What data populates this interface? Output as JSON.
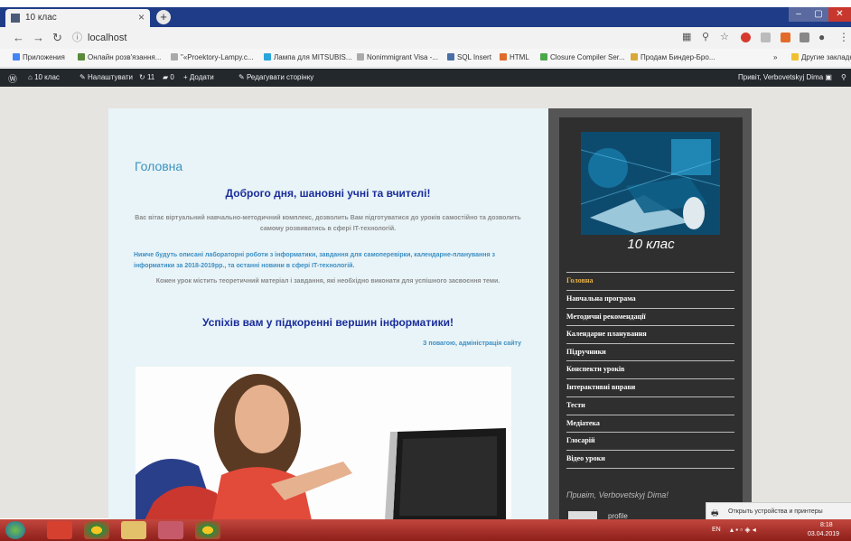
{
  "browser": {
    "tab_title": "10 клас",
    "url": "localhost",
    "bookmarks": [
      "Приложения",
      "Онлайн розв'язання...",
      "\"«Proektory-Lampy.c...",
      "Лампа для MITSUBIS...",
      "Nonimmigrant Visa -...",
      "SQL Insert",
      "HTML",
      "Closure Compiler Ser...",
      "Продам Биндер-Бро...",
      "Другие закладк"
    ]
  },
  "admin_bar": {
    "site_name": "10 клас",
    "customize": "Налаштувати",
    "updates": "11",
    "comments": "0",
    "new": "Додати",
    "edit": "Редагувати сторінку",
    "greeting": "Привіт, Verbovetskyj Dima"
  },
  "main": {
    "heading": "Головна",
    "greeting": "Доброго дня, шановні учні та вчителі!",
    "para1": "Вас вітає віртуальний навчально-методичний комплекс, дозволить Вам підготуватися до уроків самостійно та дозволить самому розвиватись в сфері IT-технологій.",
    "para2": "Нижче будуть описані лабораторні роботи з інформатики, завдання для самоперевірки, календарне-планування з інформатики за 2018-2019рр., та останні новини в сфері IT-технологій.",
    "para3": "Кожен урок містить теоретичний матеріал і завдання, які необхідно виконати для успішного засвоєння теми.",
    "success": "Успіхів вам у підкоренні вершин інформатики!",
    "signature": "З повагою, адміністрація сайту"
  },
  "sidebar": {
    "site_title": "10 клас",
    "menu": [
      "Головна",
      "Навчальна програма",
      "Методичні рекомендації",
      "Календарне планування",
      "Підручники",
      "Конспекти уроків",
      "Інтерактивні вправи",
      "Тести",
      "Медіатека",
      "Глосарій",
      "Відео уроки"
    ],
    "greet": "Привіт, Verbovetskyj Dima!",
    "profile": "profile"
  },
  "notification": {
    "text": "Открыть устройства и принтеры"
  },
  "tray": {
    "lang": "EN",
    "time": "8:18",
    "date": "03.04.2019"
  },
  "colors": {
    "active_menu": "#e8b24a",
    "accent": "#3b93c0"
  }
}
